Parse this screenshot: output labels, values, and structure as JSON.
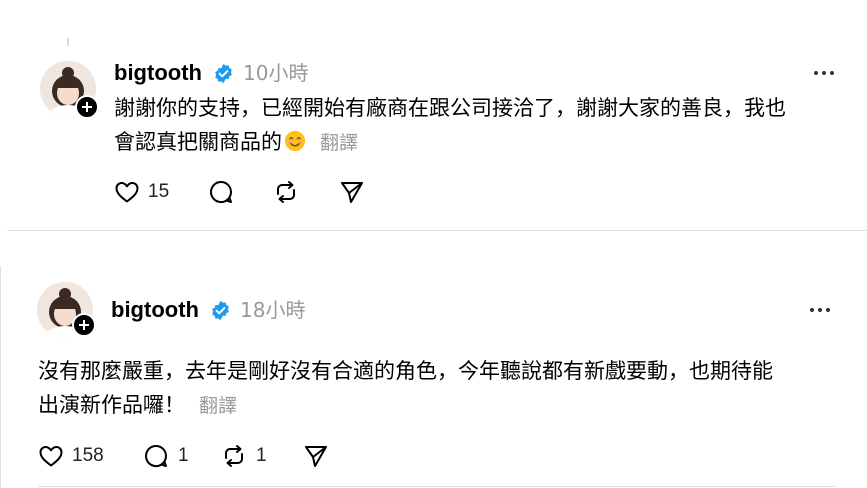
{
  "posts": [
    {
      "username": "bigtooth",
      "time": "10小時",
      "text_line1": "謝謝你的支持，已經開始有廠商在跟公司接洽了，謝謝大家的善良，我也",
      "text_line2": "會認真把關商品的",
      "emoji": "smiling-face-emoji",
      "translate": "翻譯",
      "likes": "15",
      "replies": "",
      "reposts": ""
    },
    {
      "username": "bigtooth",
      "time": "18小時",
      "text_line1": "沒有那麼嚴重，去年是剛好沒有合適的角色，今年聽說都有新戲要動，也期待能",
      "text_line2": "出演新作品囉！",
      "translate": "翻譯",
      "likes": "158",
      "replies": "1",
      "reposts": "1"
    }
  ],
  "colors": {
    "verified": "#1d9bf0",
    "muted": "#999999",
    "divider": "#e0e0e0"
  }
}
